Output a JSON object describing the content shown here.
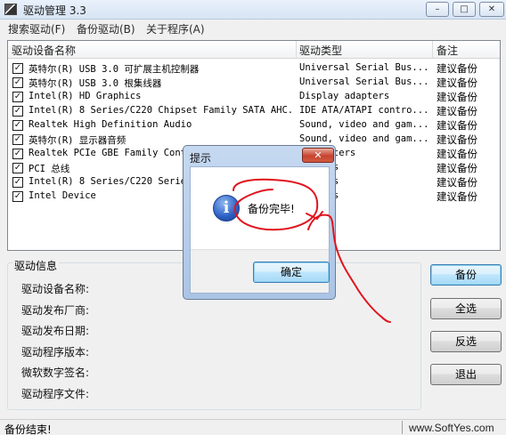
{
  "window": {
    "title": "驱动管理 3.3",
    "controls": {
      "minimize": "–",
      "maximize": "□",
      "close": "✕"
    }
  },
  "menu": [
    "搜索驱动(F)",
    "备份驱动(B)",
    "关于程序(A)"
  ],
  "list": {
    "columns": [
      "驱动设备名称",
      "驱动类型",
      "备注"
    ],
    "rows": [
      {
        "checked": true,
        "name": "英特尔(R) USB 3.0 可扩展主机控制器",
        "type": "Universal Serial Bus...",
        "note": "建议备份"
      },
      {
        "checked": true,
        "name": "英特尔(R) USB 3.0 根集线器",
        "type": "Universal Serial Bus...",
        "note": "建议备份"
      },
      {
        "checked": true,
        "name": "Intel(R) HD Graphics",
        "type": "Display adapters",
        "note": "建议备份"
      },
      {
        "checked": true,
        "name": "Intel(R) 8 Series/C220 Chipset Family SATA AHC...",
        "type": "IDE ATA/ATAPI contro...",
        "note": "建议备份"
      },
      {
        "checked": true,
        "name": "Realtek High Definition Audio",
        "type": "Sound, video and gam...",
        "note": "建议备份"
      },
      {
        "checked": true,
        "name": "英特尔(R) 显示器音频",
        "type": "Sound, video and gam...",
        "note": "建议备份"
      },
      {
        "checked": true,
        "name": "Realtek PCIe GBE Family Contr",
        "type": "k adapters",
        "note": "建议备份"
      },
      {
        "checked": true,
        "name": "PCI 总线",
        "type": "devices",
        "note": "建议备份"
      },
      {
        "checked": true,
        "name": "Intel(R) 8 Series/C220 Series",
        "type": "devices",
        "note": "建议备份"
      },
      {
        "checked": true,
        "name": "Intel Device",
        "type": "devices",
        "note": "建议备份"
      }
    ]
  },
  "info": {
    "title": "驱动信息",
    "labels": [
      "驱动设备名称:",
      "驱动发布厂商:",
      "驱动发布日期:",
      "驱动程序版本:",
      "微软数字签名:",
      "驱动程序文件:"
    ]
  },
  "buttons": {
    "backup": "备份",
    "select_all": "全选",
    "invert": "反选",
    "exit": "退出"
  },
  "status": {
    "text": "备份结束!",
    "watermark": "www.SoftYes.com"
  },
  "dialog": {
    "title": "提示",
    "close": "✕",
    "icon": "i",
    "message": "备份完毕!",
    "ok": "确定"
  },
  "checkmark": "✓",
  "colors": {
    "annotation_red": "#e0141e",
    "dialog_frame": "#aac4e6",
    "default_button": "#3c7fb1"
  }
}
